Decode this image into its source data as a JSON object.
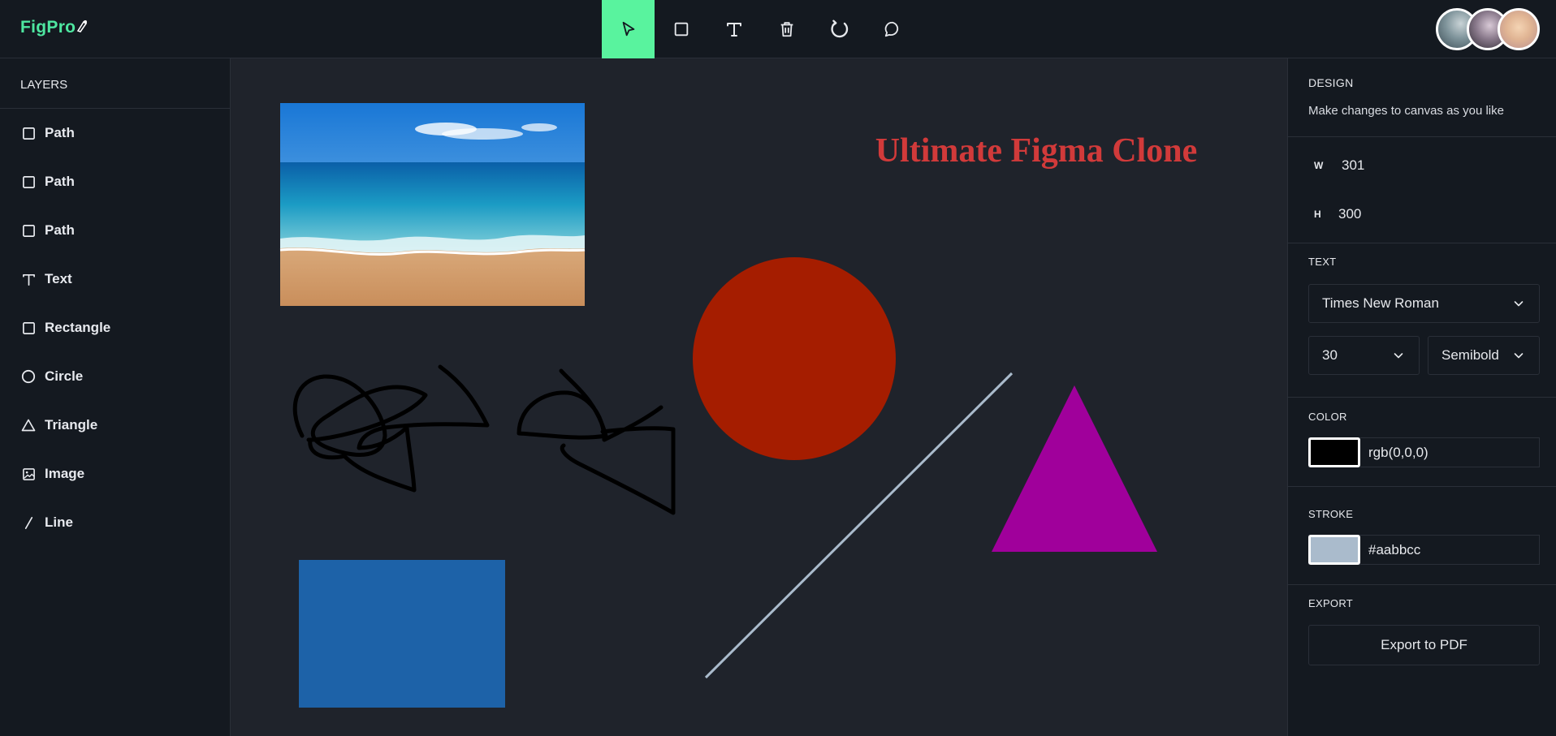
{
  "app": {
    "logo": "FigPro"
  },
  "toolbar": {
    "tools": [
      {
        "name": "select",
        "icon": "cursor-icon",
        "active": true
      },
      {
        "name": "rectangle",
        "icon": "square-icon",
        "active": false
      },
      {
        "name": "text",
        "icon": "text-icon",
        "active": false
      },
      {
        "name": "delete",
        "icon": "trash-icon",
        "active": false
      },
      {
        "name": "reset",
        "icon": "reset-icon",
        "active": false
      },
      {
        "name": "comments",
        "icon": "comment-icon",
        "active": false
      }
    ],
    "active_color": "#59f39e"
  },
  "layers": {
    "title": "LAYERS",
    "items": [
      {
        "label": "Path",
        "icon": "square-icon"
      },
      {
        "label": "Path",
        "icon": "square-icon"
      },
      {
        "label": "Path",
        "icon": "square-icon"
      },
      {
        "label": "Text",
        "icon": "text-icon"
      },
      {
        "label": "Rectangle",
        "icon": "square-icon"
      },
      {
        "label": "Circle",
        "icon": "circle-icon"
      },
      {
        "label": "Triangle",
        "icon": "triangle-icon"
      },
      {
        "label": "Image",
        "icon": "image-icon"
      },
      {
        "label": "Line",
        "icon": "line-icon"
      }
    ]
  },
  "canvas": {
    "heading_text": "Ultimate Figma Clone",
    "heading_color": "#d13a3a",
    "circle_color": "#a51d00",
    "triangle_color": "#a0009b",
    "rectangle_color": "#1d62a8",
    "line_color": "#aabbcc",
    "path_color": "#000000"
  },
  "design": {
    "title": "DESIGN",
    "subtitle": "Make changes to canvas as you like",
    "w_label": "W",
    "w_value": "301",
    "h_label": "H",
    "h_value": "300",
    "text_section": "TEXT",
    "font_family": "Times New Roman",
    "font_size": "30",
    "font_weight": "Semibold",
    "color_section": "COLOR",
    "color_value": "rgb(0,0,0)",
    "stroke_section": "STROKE",
    "stroke_value": "#aabbcc",
    "export_section": "EXPORT",
    "export_label": "Export to PDF"
  }
}
